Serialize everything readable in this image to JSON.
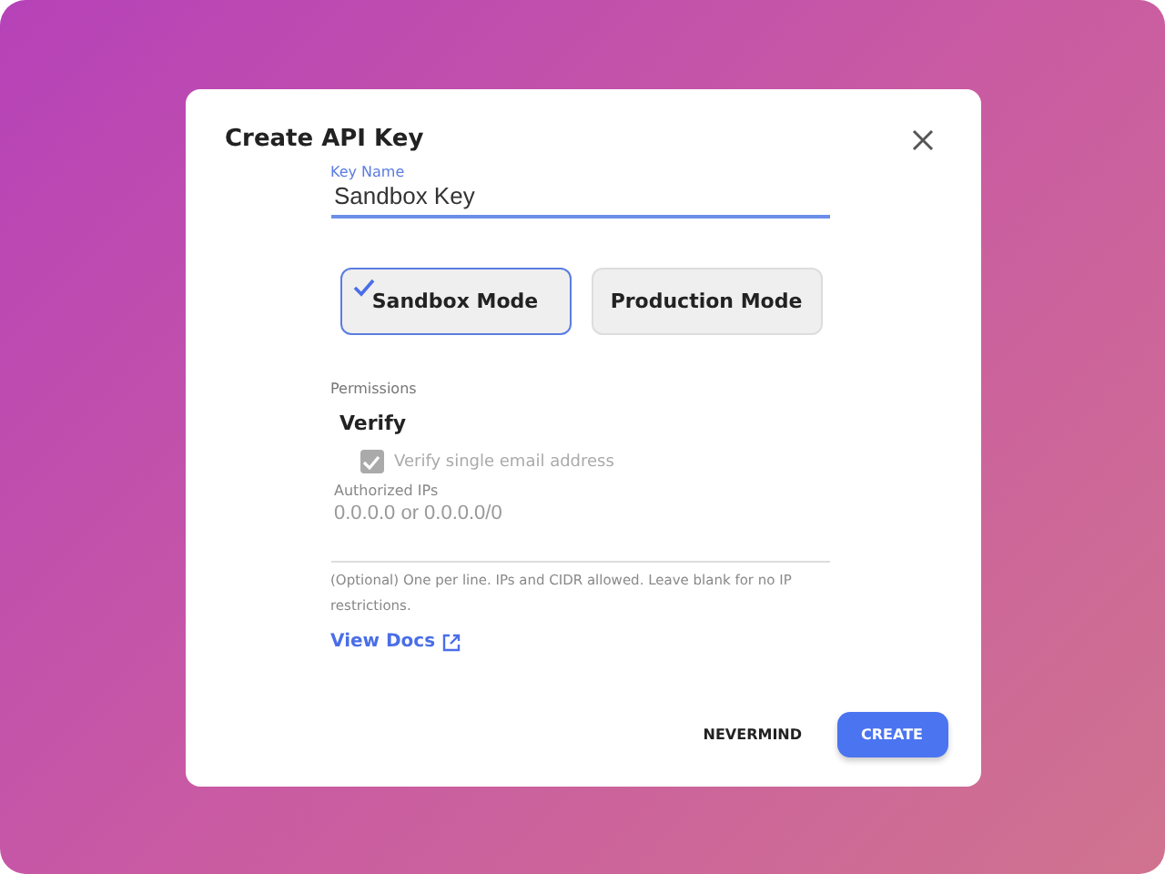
{
  "dialog": {
    "title": "Create API Key"
  },
  "key_name": {
    "label": "Key Name",
    "value": "Sandbox Key"
  },
  "modes": [
    {
      "label": "Sandbox Mode",
      "selected": true
    },
    {
      "label": "Production Mode",
      "selected": false
    }
  ],
  "permissions": {
    "label": "Permissions",
    "group": "Verify",
    "items": [
      {
        "label": "Verify single email address",
        "checked": true,
        "disabled": true
      }
    ]
  },
  "authorized_ips": {
    "label": "Authorized IPs",
    "placeholder": "0.0.0.0 or 0.0.0.0/0",
    "helper": "(Optional) One per line. IPs and CIDR allowed. Leave blank for no IP restrictions."
  },
  "docs_link": "View Docs",
  "buttons": [
    {
      "label": "NEVERMIND",
      "kind": "text"
    },
    {
      "label": "CREATE",
      "kind": "primary"
    }
  ]
}
